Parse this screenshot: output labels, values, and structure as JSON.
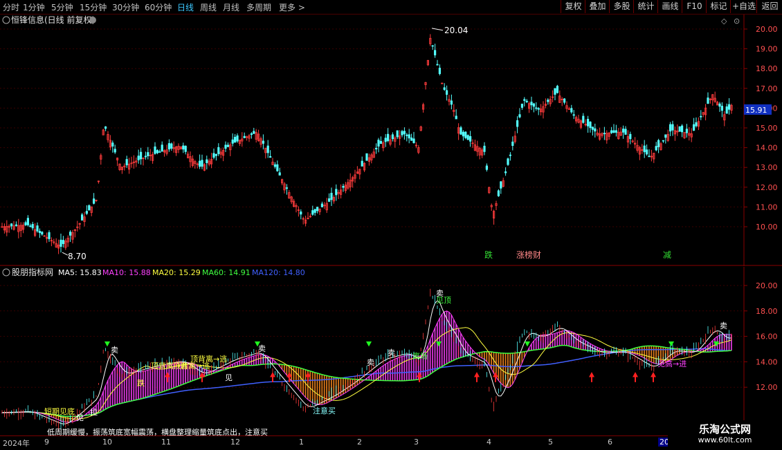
{
  "toolbar": {
    "timeframes": [
      "分时",
      "1分钟",
      "5分钟",
      "15分钟",
      "30分钟",
      "60分钟",
      "日线",
      "周线",
      "月线",
      "多周期",
      "更多"
    ],
    "active": "日线",
    "right_buttons": [
      "复权",
      "叠加",
      "多股",
      "统计",
      "画线",
      "F10",
      "标记",
      "+自选",
      "返回"
    ]
  },
  "price_panel": {
    "title": "恒锋信息(日线 前复权)",
    "high_label": "20.04",
    "low_label": "8.70",
    "current_price": "15.91",
    "y_ticks": [
      "20.00",
      "19.00",
      "18.00",
      "17.00",
      "16.00",
      "15.00",
      "14.00",
      "13.00",
      "12.00",
      "11.00",
      "10.00"
    ],
    "event_tags": [
      {
        "text": "跌",
        "color": "#33dd33"
      },
      {
        "text": "涨榜财",
        "color": "#ff8888"
      },
      {
        "text": "减",
        "color": "#33dd33"
      }
    ],
    "colors": {
      "up": "#ff3c3c",
      "down": "#54ffff"
    }
  },
  "indicator_panel": {
    "title": "股朋指标网",
    "ma": [
      {
        "label": "MA5: 15.83",
        "color": "#ffffff"
      },
      {
        "label": "MA10: 15.88",
        "color": "#ff40ff"
      },
      {
        "label": "MA20: 15.29",
        "color": "#ffff40"
      },
      {
        "label": "MA60: 14.91",
        "color": "#40ff40"
      },
      {
        "label": "MA120: 14.80",
        "color": "#4060ff"
      }
    ],
    "y_ticks": [
      "20.00",
      "18.00",
      "16.00",
      "14.00",
      "12.00"
    ],
    "annotations": [
      "卖",
      "卖",
      "卖",
      "卖",
      "卖",
      "卖",
      "顶背离→逃",
      "顶背离→逃",
      "跌",
      "见",
      "注意买",
      "短期见底",
      "离场",
      "见顶",
      "见高→进",
      "顶背离→逃",
      "拉",
      "见"
    ],
    "banner": "低周期缓慢，振荡筑底宽幅震荡，横盘整理缩量筑底点出，注意买"
  },
  "time_axis": {
    "labels": [
      "2024年",
      "9",
      "10",
      "11",
      "12",
      "1",
      "2",
      "3",
      "4",
      "5",
      "6",
      "2025"
    ]
  },
  "watermark": {
    "line1": "乐淘公式网",
    "line2": "www.60lt.com"
  }
}
